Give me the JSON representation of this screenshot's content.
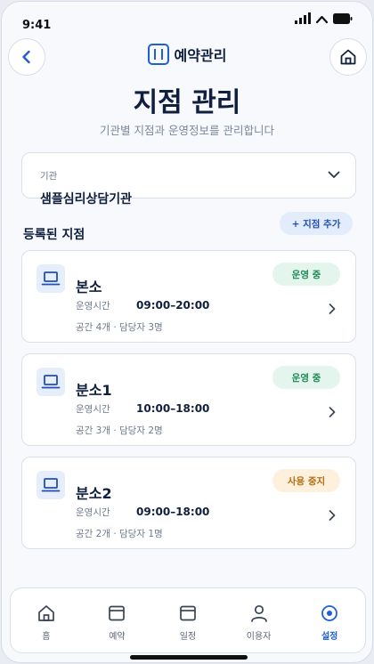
{
  "status_bar": {
    "time": "9:41"
  },
  "header": {
    "app_name": "예약관리",
    "back_icon": "chevron-left-icon",
    "home_icon": "home-icon"
  },
  "page": {
    "title": "지점 관리",
    "subtitle": "기관별 지점과 운영정보를 관리합니다"
  },
  "org_select": {
    "label": "기관",
    "value": "샘플심리상담기관"
  },
  "branches_section": {
    "title": "등록된 지점",
    "add_label": "+ 지점 추가"
  },
  "branches": [
    {
      "name": "본소",
      "hours_label": "운영시간",
      "hours": "09:00–20:00",
      "meta": "공간 4개 · 담당자 3명",
      "status": "운영 중"
    },
    {
      "name": "분소1",
      "hours_label": "운영시간",
      "hours": "10:00–18:00",
      "meta": "공간 3개 · 담당자 2명",
      "status": "운영 중"
    },
    {
      "name": "분소2",
      "hours_label": "운영시간",
      "hours": "09:00–18:00",
      "meta": "공간 2개 · 담당자 1명",
      "status": "사용 중지"
    }
  ],
  "tabs": [
    {
      "label": "홈",
      "icon": "home-icon"
    },
    {
      "label": "예약",
      "icon": "calendar-icon"
    },
    {
      "label": "일정",
      "icon": "schedule-icon"
    },
    {
      "label": "이용자",
      "icon": "user-icon"
    },
    {
      "label": "설정",
      "icon": "settings-icon"
    }
  ],
  "colors": {
    "accent": "#1f5fd6",
    "title": "#0f1f3d",
    "status_active_bg": "#e3f5ec",
    "status_active_text": "#1d8a57",
    "status_paused_bg": "#fdf0dc",
    "status_paused_text": "#b76e12"
  }
}
